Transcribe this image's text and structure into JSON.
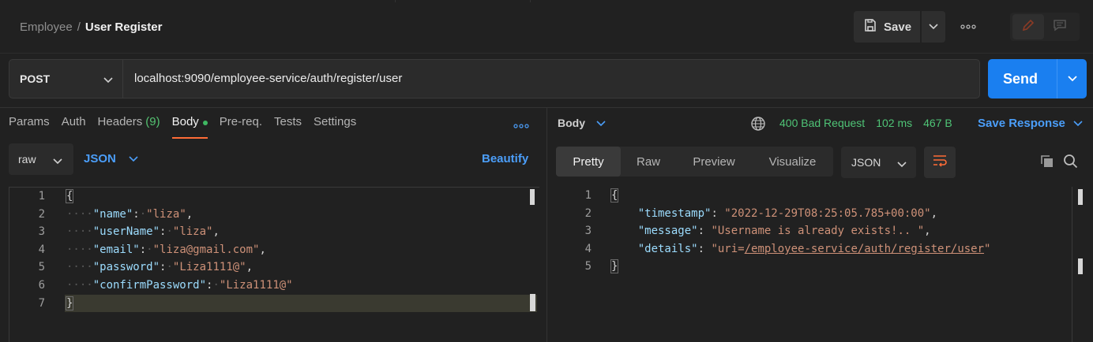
{
  "breadcrumb": {
    "parent": "Employee",
    "separator": "/",
    "current": "User Register"
  },
  "toolbar": {
    "save_label": "Save",
    "more": "ooo"
  },
  "request": {
    "method": "POST",
    "url": "localhost:9090/employee-service/auth/register/user",
    "send_label": "Send"
  },
  "request_tabs": [
    {
      "label": "Params"
    },
    {
      "label": "Auth"
    },
    {
      "label": "Headers",
      "count": "(9)"
    },
    {
      "label": "Body",
      "active": true
    },
    {
      "label": "Pre-req."
    },
    {
      "label": "Tests"
    },
    {
      "label": "Settings"
    }
  ],
  "request_more": "ooo",
  "body_mode": {
    "type": "raw",
    "format": "JSON",
    "beautify": "Beautify"
  },
  "request_body": {
    "line_numbers": [
      "1",
      "2",
      "3",
      "4",
      "5",
      "6",
      "7"
    ],
    "lines": [
      {
        "key": "\"name\"",
        "value": "\"liza\"",
        "comma": ","
      },
      {
        "key": "\"userName\"",
        "value": "\"liza\"",
        "comma": ","
      },
      {
        "key": "\"email\"",
        "value": "\"liza@gmail.com\"",
        "comma": ","
      },
      {
        "key": "\"password\"",
        "value": "\"Liza1111@\"",
        "comma": ","
      },
      {
        "key": "\"confirmPassword\"",
        "value": "\"Liza1111@\"",
        "comma": ""
      }
    ],
    "open_brace": "{",
    "close_brace": "}"
  },
  "response_header": {
    "label": "Body",
    "status": "400 Bad Request",
    "time": "102 ms",
    "size": "467 B",
    "save_response": "Save Response"
  },
  "response_tabs": [
    {
      "label": "Pretty",
      "active": true
    },
    {
      "label": "Raw"
    },
    {
      "label": "Preview"
    },
    {
      "label": "Visualize"
    }
  ],
  "response_format": "JSON",
  "response_body": {
    "line_numbers": [
      "1",
      "2",
      "3",
      "4",
      "5"
    ],
    "lines": [
      {
        "key": "\"timestamp\"",
        "value": "\"2022-12-29T08:25:05.785+00:00\"",
        "comma": ","
      },
      {
        "key": "\"message\"",
        "value": "\"Username is already exists!.. \"",
        "comma": ","
      },
      {
        "key": "\"details\"",
        "value_prefix": "\"uri=",
        "value_link": "/employee-service/auth/register/user",
        "value_suffix": "\"",
        "comma": ""
      }
    ],
    "open_brace": "{",
    "close_brace": "}"
  },
  "colors": {
    "accent_orange": "#ff6c37",
    "send_blue": "#1a7ff0",
    "link_blue": "#4b9ef9",
    "status_green": "#4fc476"
  }
}
